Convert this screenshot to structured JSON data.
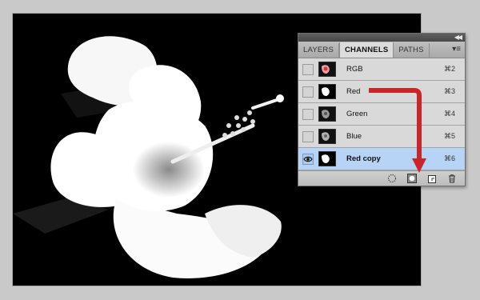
{
  "panel": {
    "tabs": [
      {
        "label": "LAYERS",
        "active": false
      },
      {
        "label": "CHANNELS",
        "active": true
      },
      {
        "label": "PATHS",
        "active": false
      }
    ],
    "channels": [
      {
        "name": "RGB",
        "shortcut": "⌘2",
        "visible": false,
        "selected": false,
        "thumb": "rgb"
      },
      {
        "name": "Red",
        "shortcut": "⌘3",
        "visible": false,
        "selected": false,
        "thumb": "red"
      },
      {
        "name": "Green",
        "shortcut": "⌘4",
        "visible": false,
        "selected": false,
        "thumb": "green"
      },
      {
        "name": "Blue",
        "shortcut": "⌘5",
        "visible": false,
        "selected": false,
        "thumb": "blue"
      },
      {
        "name": "Red copy",
        "shortcut": "⌘6",
        "visible": true,
        "selected": true,
        "thumb": "redcopy"
      }
    ],
    "bottom_icons": [
      "load-selection-icon",
      "save-selection-icon",
      "new-channel-icon",
      "trash-icon"
    ]
  },
  "colors": {
    "arrow": "#c8262b",
    "selected_row": "#b7d3f5",
    "panel_bg": "#d9d9d9"
  }
}
